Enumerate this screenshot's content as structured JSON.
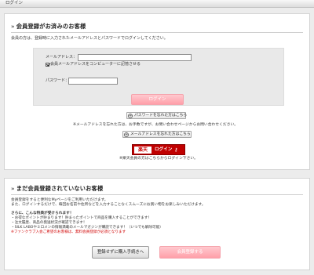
{
  "header": {
    "title": "ログイン"
  },
  "member": {
    "title": "会員登録がお済みのお客様",
    "intro": "会員の方は、登録時に入力されたメールアドレスとパスワードでログインしてください。",
    "email_label": "メールアドレス：",
    "email_value": "",
    "remember_label": "会員メールアドレスをコンピューターに記憶させる",
    "remember_checked": true,
    "password_label": "パスワード：",
    "password_value": "",
    "login_button": "ログイン",
    "forgot_password_button": "パスワードを忘れた方はこちら",
    "forgot_email_note": "※メールアドレスを忘れた方は、お手数ですが、お問い合わせページからお問い合わせください。",
    "forgot_email_button": "メールアドレスを忘れた方はこちら",
    "rakuten_logo": "楽天",
    "rakuten_login_label": "ログイン",
    "rakuten_note": "※楽天会員の方はこちらからログイン下さい。"
  },
  "nonmember": {
    "title": "まだ会員登録されていないお客様",
    "intro_1": "会員登録をすると便利なMyページをご利用いただけます。",
    "intro_2": "また、ログインするだけで、毎回お名前や住所などを入力することなくスムーズにお買い物をお楽しみいただけます。",
    "benefits_heading": "さらに、こんな特典が受けられます！",
    "benefits": [
      "・お得なポイントが貯まります！貯まったポイントで商品を購入することができます！",
      "・注文履歴、商品の発送状況が確認できます！",
      "・SILK LABOやミロメンの情報満載のメールマガジンが購読できます！（いつでも解除可能）"
    ],
    "fanclub_note": "※ファンクラブ入会ご希望のお客様は、無料会員登録が必須となります",
    "guest_button": "登録せずに購入手続きへ",
    "register_button": "会員登録する"
  },
  "colors": {
    "accent_pink": "#ff9fa9",
    "rakuten_red": "#c00000",
    "notice_red": "#d00000"
  }
}
